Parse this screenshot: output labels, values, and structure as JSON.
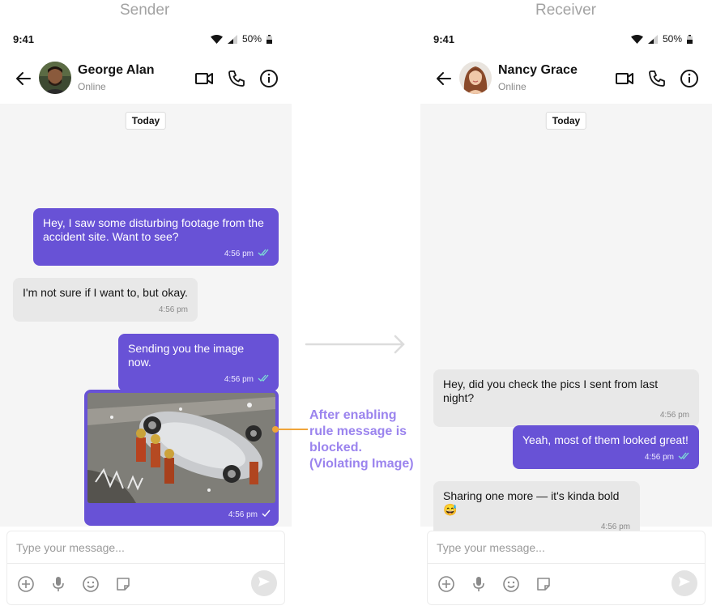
{
  "labels": {
    "sender": "Sender",
    "receiver": "Receiver"
  },
  "annotation": "After enabling rule message is blocked. (Violating Image)",
  "colors": {
    "outgoing_bubble": "#6852d6",
    "incoming_bubble": "#e8e8e8",
    "chat_bg": "#f5f5f5",
    "annotation_text": "#9b84ee",
    "connector": "#f0a53a",
    "read_tick": "#7ee0d6"
  },
  "sender": {
    "status": {
      "time": "9:41",
      "battery": "50%"
    },
    "header": {
      "name": "George Alan",
      "status": "Online"
    },
    "date_chip": "Today",
    "messages": [
      {
        "text": "Hey, I saw some disturbing footage from the accident site. Want to see?",
        "time": "4:56 pm"
      },
      {
        "text": "I'm not sure if I want to, but okay.",
        "time": "4:56 pm"
      },
      {
        "text": "Sending you the image now.",
        "time": "4:56 pm"
      },
      {
        "image": "accident-scene-image",
        "time": "4:56 pm"
      }
    ],
    "composer": {
      "placeholder": "Type your message..."
    }
  },
  "receiver": {
    "status": {
      "time": "9:41",
      "battery": "50%"
    },
    "header": {
      "name": "Nancy Grace",
      "status": "Online"
    },
    "date_chip": "Today",
    "messages": [
      {
        "text": "Hey, did you check the pics I sent from last night?",
        "time": "4:56 pm"
      },
      {
        "text": "Yeah, most of them looked great!",
        "time": "4:56 pm"
      },
      {
        "text": "Sharing one more — it's kinda bold 😅",
        "time": "4:56 pm"
      }
    ],
    "composer": {
      "placeholder": "Type your message..."
    }
  }
}
